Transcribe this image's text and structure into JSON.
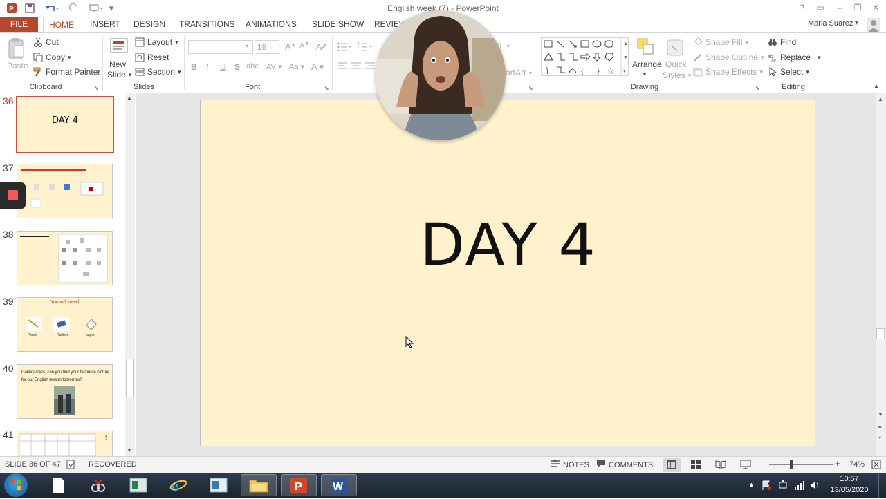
{
  "window": {
    "title": "English  week (7) - PowerPoint",
    "user": "Maria Suarez"
  },
  "tabs": [
    {
      "label": "FILE"
    },
    {
      "label": "HOME"
    },
    {
      "label": "INSERT"
    },
    {
      "label": "DESIGN"
    },
    {
      "label": "TRANSITIONS"
    },
    {
      "label": "ANIMATIONS"
    },
    {
      "label": "SLIDE SHOW"
    },
    {
      "label": "REVIEW"
    }
  ],
  "ribbon": {
    "clipboard": {
      "paste": "Paste",
      "cut": "Cut",
      "copy": "Copy",
      "format_painter": "Format Painter",
      "label": "Clipboard"
    },
    "slides": {
      "new_slide_1": "New",
      "new_slide_2": "Slide",
      "layout": "Layout",
      "reset": "Reset",
      "section": "Section",
      "label": "Slides"
    },
    "font": {
      "font_size": "18",
      "label": "Font",
      "bold": "B",
      "italic": "I",
      "underline": "U",
      "shadow": "S",
      "strike": "abc"
    },
    "paragraph": {
      "partial_an": "an",
      "smartart": "artArt"
    },
    "drawing": {
      "arrange": "Arrange",
      "quick_styles_1": "Quick",
      "quick_styles_2": "Styles",
      "shape_fill": "Shape Fill",
      "shape_outline": "Shape Outline",
      "shape_effects": "Shape Effects",
      "label": "Drawing"
    },
    "editing": {
      "find": "Find",
      "replace": "Replace",
      "select": "Select",
      "label": "Editing"
    }
  },
  "thumbnails": [
    {
      "num": "36",
      "title": "DAY 4"
    },
    {
      "num": "37",
      "title": ""
    },
    {
      "num": "38",
      "title": ""
    },
    {
      "num": "39",
      "title": "You will need",
      "items": [
        "Pencil",
        "Rubber",
        "paper"
      ]
    },
    {
      "num": "40",
      "title": "Galaxy class, can you find your favourite picture for our English lesson tomorrow?"
    },
    {
      "num": "41",
      "title": ""
    }
  ],
  "slide": {
    "title": "DAY 4"
  },
  "status": {
    "slide_info": "SLIDE 36 OF 47",
    "recovered": "RECOVERED",
    "notes": "NOTES",
    "comments": "COMMENTS",
    "zoom": "74%"
  },
  "taskbar": {
    "time": "10:57",
    "date": "13/05/2020"
  },
  "colors": {
    "accent": "#b7472a",
    "slide_bg": "#fff2cc",
    "selected_border": "#c0504d"
  }
}
